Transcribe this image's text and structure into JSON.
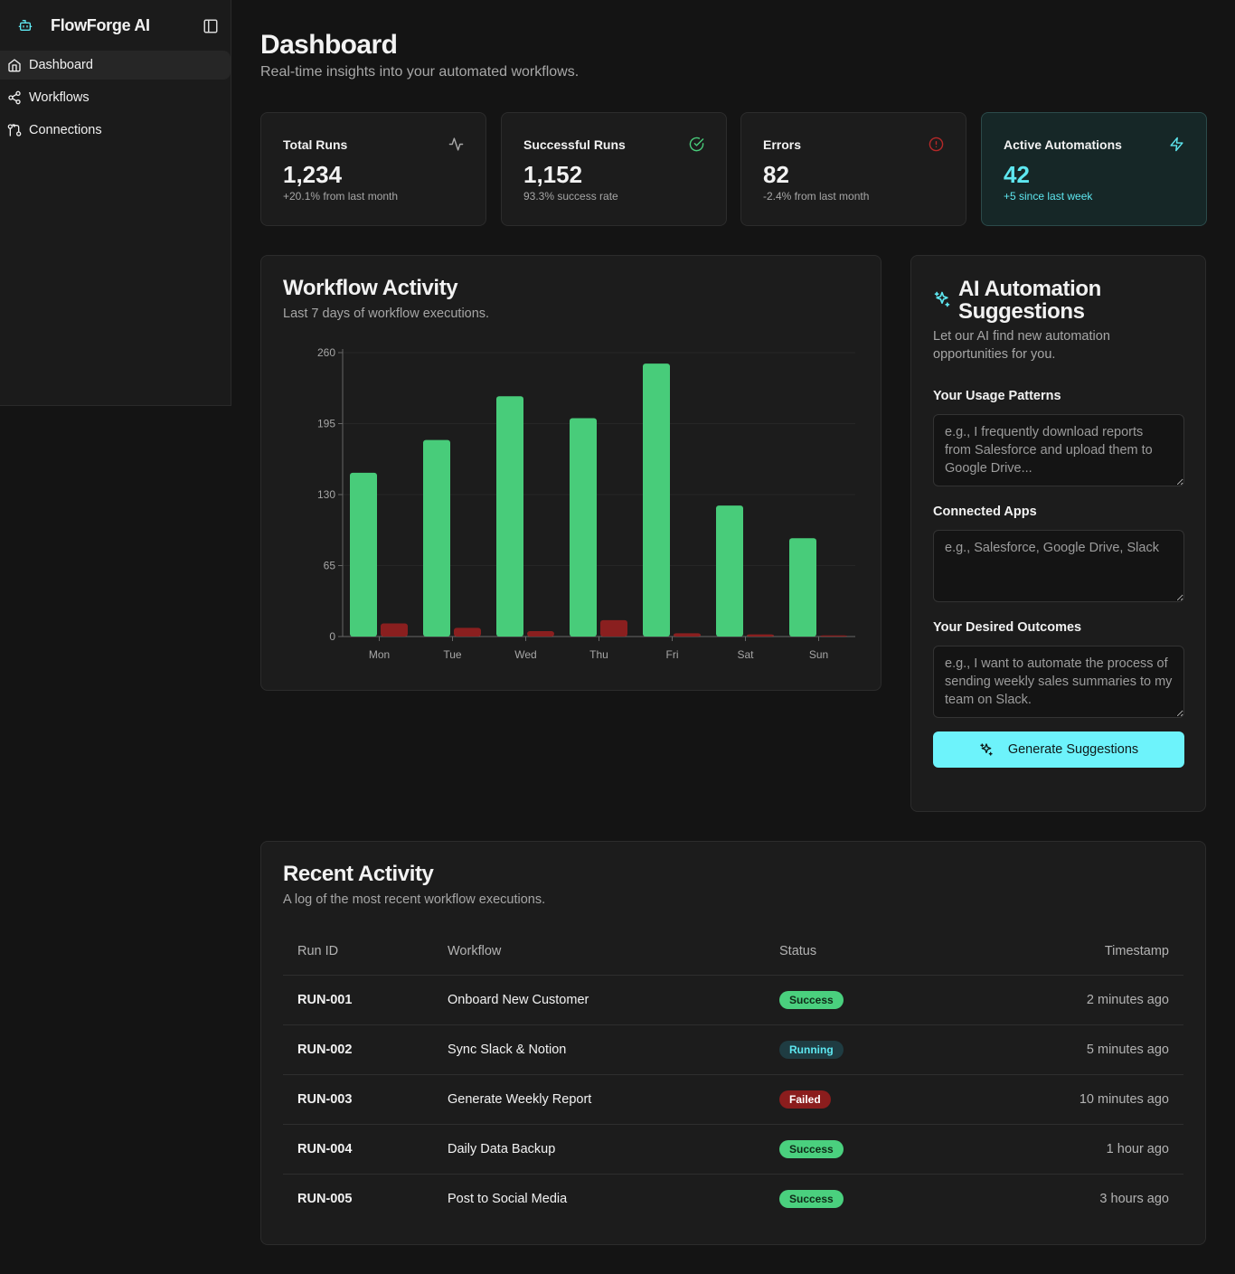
{
  "app": {
    "name": "FlowForge AI"
  },
  "sidebar": {
    "items": [
      {
        "label": "Dashboard",
        "icon": "home-icon",
        "active": true
      },
      {
        "label": "Workflows",
        "icon": "share-nodes-icon",
        "active": false
      },
      {
        "label": "Connections",
        "icon": "git-compare-icon",
        "active": false
      }
    ]
  },
  "header": {
    "title": "Dashboard",
    "subtitle": "Real-time insights into your automated workflows."
  },
  "stats": [
    {
      "label": "Total Runs",
      "value": "1,234",
      "note": "+20.1% from last month",
      "icon": "activity-icon"
    },
    {
      "label": "Successful Runs",
      "value": "1,152",
      "note": "93.3% success rate",
      "icon": "check-circle-icon"
    },
    {
      "label": "Errors",
      "value": "82",
      "note": "-2.4% from last month",
      "icon": "alert-circle-icon"
    },
    {
      "label": "Active Automations",
      "value": "42",
      "note": "+5 since last week",
      "icon": "zap-icon"
    }
  ],
  "activity": {
    "title": "Workflow Activity",
    "subtitle": "Last 7 days of workflow executions."
  },
  "chart_data": {
    "type": "bar",
    "categories": [
      "Mon",
      "Tue",
      "Wed",
      "Thu",
      "Fri",
      "Sat",
      "Sun"
    ],
    "series": [
      {
        "values": [
          150,
          180,
          220,
          200,
          250,
          120,
          90
        ],
        "color": "#48cc7a"
      },
      {
        "values": [
          12,
          8,
          5,
          15,
          3,
          2,
          1
        ],
        "color": "#8a1f1f"
      }
    ],
    "yticks": [
      0,
      65,
      130,
      195,
      260
    ],
    "ylim": [
      0,
      260
    ],
    "grid": true,
    "legend": "none"
  },
  "ai": {
    "title": "AI Automation Suggestions",
    "subtitle": "Let our AI find new automation opportunities for you.",
    "usage_label": "Your Usage Patterns",
    "usage_placeholder": "e.g., I frequently download reports from Salesforce and upload them to Google Drive...",
    "apps_label": "Connected Apps",
    "apps_placeholder": "e.g., Salesforce, Google Drive, Slack",
    "outcomes_label": "Your Desired Outcomes",
    "outcomes_placeholder": "e.g., I want to automate the process of sending weekly sales summaries to my team on Slack.",
    "button_label": "Generate Suggestions"
  },
  "recent": {
    "title": "Recent Activity",
    "subtitle": "A log of the most recent workflow executions.",
    "columns": [
      "Run ID",
      "Workflow",
      "Status",
      "Timestamp"
    ],
    "rows": [
      {
        "id": "RUN-001",
        "workflow": "Onboard New Customer",
        "status": "Success",
        "status_kind": "success",
        "time": "2 minutes ago"
      },
      {
        "id": "RUN-002",
        "workflow": "Sync Slack & Notion",
        "status": "Running",
        "status_kind": "running",
        "time": "5 minutes ago"
      },
      {
        "id": "RUN-003",
        "workflow": "Generate Weekly Report",
        "status": "Failed",
        "status_kind": "failed",
        "time": "10 minutes ago"
      },
      {
        "id": "RUN-004",
        "workflow": "Daily Data Backup",
        "status": "Success",
        "status_kind": "success",
        "time": "1 hour ago"
      },
      {
        "id": "RUN-005",
        "workflow": "Post to Social Media",
        "status": "Success",
        "status_kind": "success",
        "time": "3 hours ago"
      }
    ]
  },
  "colors": {
    "accent": "#6df3fb",
    "success": "#48cc7a",
    "error": "#d63a3a",
    "background": "#141414",
    "card": "#1c1c1c"
  }
}
